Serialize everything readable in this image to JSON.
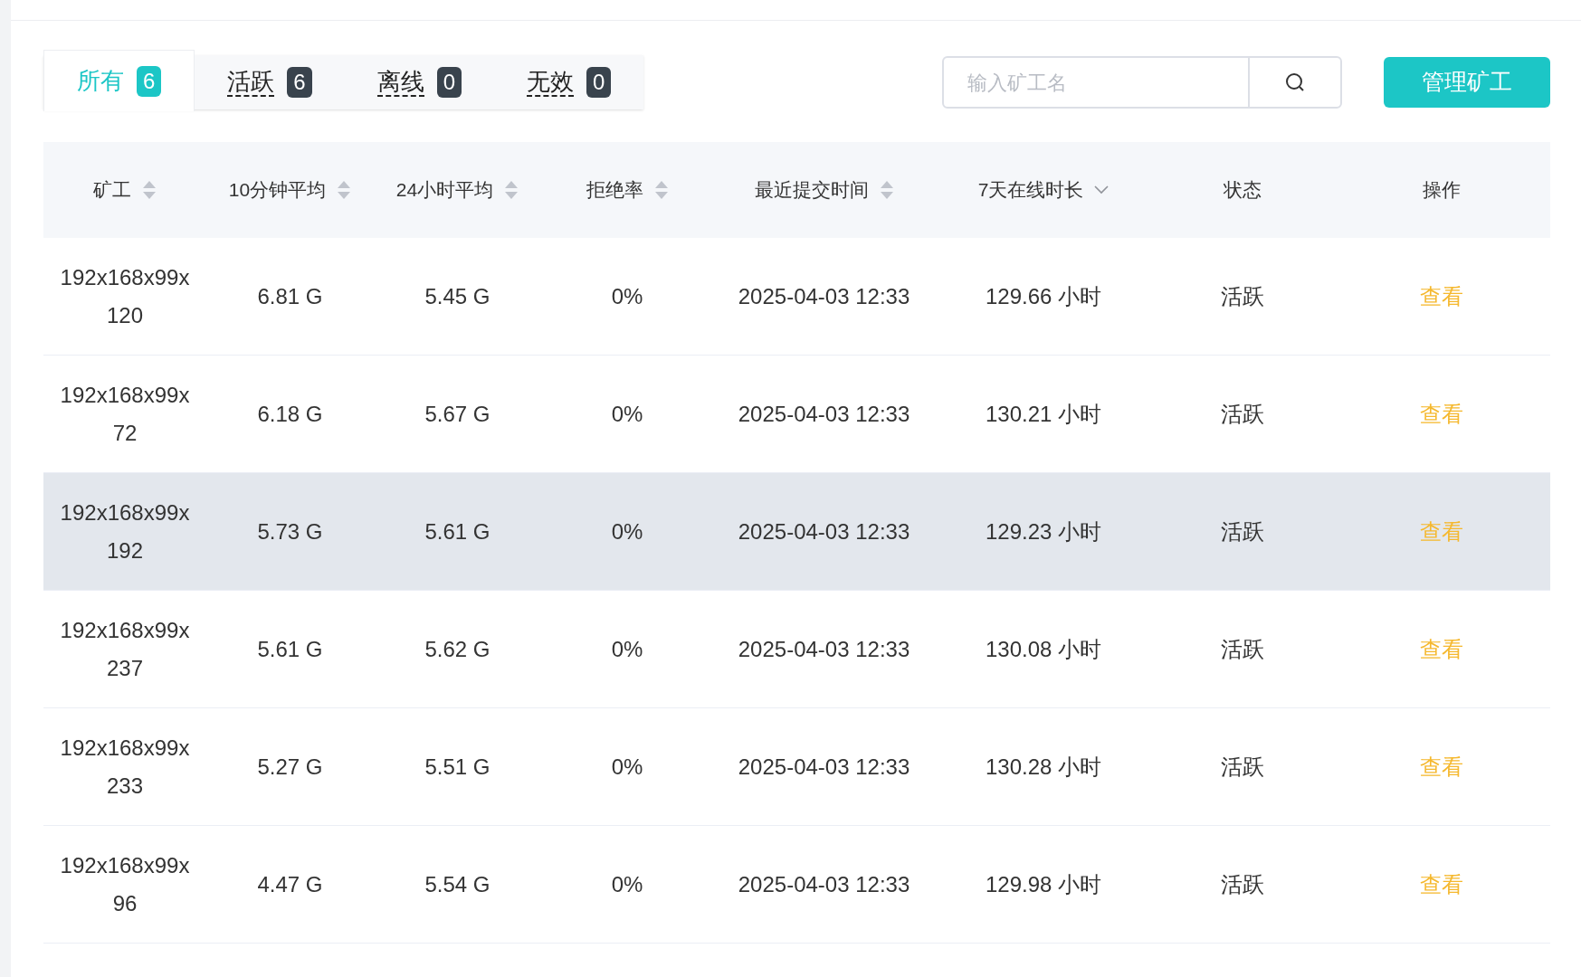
{
  "tabs": [
    {
      "label": "所有",
      "count": "6",
      "selected": true
    },
    {
      "label": "活跃",
      "count": "6",
      "selected": false
    },
    {
      "label": "离线",
      "count": "0",
      "selected": false
    },
    {
      "label": "无效",
      "count": "0",
      "selected": false
    }
  ],
  "search": {
    "placeholder": "输入矿工名"
  },
  "manage_button": "管理矿工",
  "table": {
    "columns": [
      {
        "label": "矿工",
        "kind": "sortable"
      },
      {
        "label": "10分钟平均",
        "kind": "sortable"
      },
      {
        "label": "24小时平均",
        "kind": "sortable"
      },
      {
        "label": "拒绝率",
        "kind": "sortable"
      },
      {
        "label": "最近提交时间",
        "kind": "sortable"
      },
      {
        "label": "7天在线时长",
        "kind": "descending"
      },
      {
        "label": "状态",
        "kind": "plain"
      },
      {
        "label": "操作",
        "kind": "plain"
      }
    ],
    "rows": [
      {
        "miner": "192x168x99x120",
        "avg10m": "6.81 G",
        "avg24h": "5.45 G",
        "reject": "0%",
        "last": "2025-04-03 12:33",
        "online": "129.66 小时",
        "status": "活跃",
        "action": "查看",
        "highlighted": false
      },
      {
        "miner": "192x168x99x72",
        "avg10m": "6.18 G",
        "avg24h": "5.67 G",
        "reject": "0%",
        "last": "2025-04-03 12:33",
        "online": "130.21 小时",
        "status": "活跃",
        "action": "查看",
        "highlighted": false
      },
      {
        "miner": "192x168x99x192",
        "avg10m": "5.73 G",
        "avg24h": "5.61 G",
        "reject": "0%",
        "last": "2025-04-03 12:33",
        "online": "129.23 小时",
        "status": "活跃",
        "action": "查看",
        "highlighted": true
      },
      {
        "miner": "192x168x99x237",
        "avg10m": "5.61 G",
        "avg24h": "5.62 G",
        "reject": "0%",
        "last": "2025-04-03 12:33",
        "online": "130.08 小时",
        "status": "活跃",
        "action": "查看",
        "highlighted": false
      },
      {
        "miner": "192x168x99x233",
        "avg10m": "5.27 G",
        "avg24h": "5.51 G",
        "reject": "0%",
        "last": "2025-04-03 12:33",
        "online": "130.28 小时",
        "status": "活跃",
        "action": "查看",
        "highlighted": false
      },
      {
        "miner": "192x168x99x96",
        "avg10m": "4.47 G",
        "avg24h": "5.54 G",
        "reject": "0%",
        "last": "2025-04-03 12:33",
        "online": "129.98 小时",
        "status": "活跃",
        "action": "查看",
        "highlighted": false
      }
    ]
  }
}
